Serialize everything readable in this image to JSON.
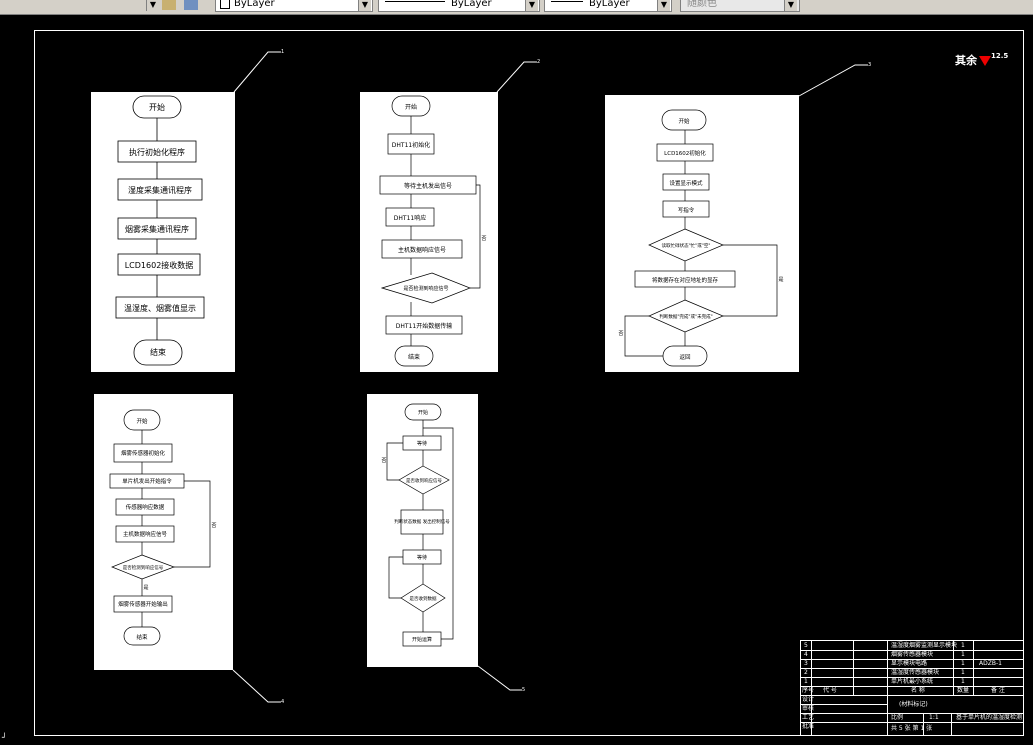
{
  "toolbar": {
    "layer": "ByLayer",
    "linetype": "ByLayer",
    "lineweight": "ByLayer",
    "color": "随颜色"
  },
  "roughness": {
    "text": "其余",
    "value": "12.5"
  },
  "sheet1": {
    "callout": "1",
    "steps": [
      "开始",
      "执行初始化程序",
      "湿度采集通讯程序",
      "烟雾采集通讯程序",
      "LCD1602接收数据",
      "温湿度、烟雾值显示",
      "结束"
    ]
  },
  "sheet2": {
    "callout": "2",
    "steps": [
      "开始",
      "DHT11初始化",
      "等待主机发出信号",
      "DHT11响应",
      "主机数据响应信号",
      "是否检测到响应信号",
      "DHT11开始数据传输",
      "结束"
    ],
    "no_label": "否"
  },
  "sheet3": {
    "callout": "3",
    "steps": [
      "开始",
      "LCD1602初始化",
      "设置显示模式",
      "写指令",
      "读取忙碌状态\"忙\"或\"空\"",
      "将数据存在对应地址的显存",
      "判断数据\"完成\"或\"未完成\"",
      "返回"
    ],
    "labels": [
      "是",
      "否"
    ]
  },
  "sheet4": {
    "callout": "4",
    "steps": [
      "开始",
      "烟雾传感器初始化",
      "单片机发出开始指令",
      "传感器响应数据",
      "主机数据响应信号",
      "是否检测到响应信号",
      "烟雾传感器开始输出",
      "结束"
    ],
    "no_label": "否",
    "yes_label": "是"
  },
  "sheet5": {
    "callout": "5",
    "steps": [
      "开始",
      "等待",
      "是否收到响应信号",
      "判断状态数据\n发出控制信号",
      "等待",
      "是否收到数据",
      "开始运算"
    ],
    "no_label": "否"
  },
  "title_block": {
    "rows": [
      [
        "5",
        "温湿度烟雾监测显示模块",
        "1",
        ""
      ],
      [
        "4",
        "烟雾传感器模块",
        "1",
        ""
      ],
      [
        "3",
        "显示模块电路",
        "1",
        "ADZB-1"
      ],
      [
        "2",
        "温湿度传感器模块",
        "1",
        ""
      ],
      [
        "1",
        "单片机最小系统",
        "1",
        ""
      ]
    ],
    "header": [
      "序号",
      "代 号",
      "名 称",
      "数量",
      "备 注"
    ],
    "design": "设计",
    "check": "审核",
    "process": "工艺",
    "approve": "批准",
    "drawing_title": "基于单片机的温湿度检测",
    "ratio": "比例",
    "ratio_value": "1:1",
    "sheet_info": "共 5 张  第 1 张",
    "material": "(材料标记)"
  },
  "corner_mark": "┘"
}
